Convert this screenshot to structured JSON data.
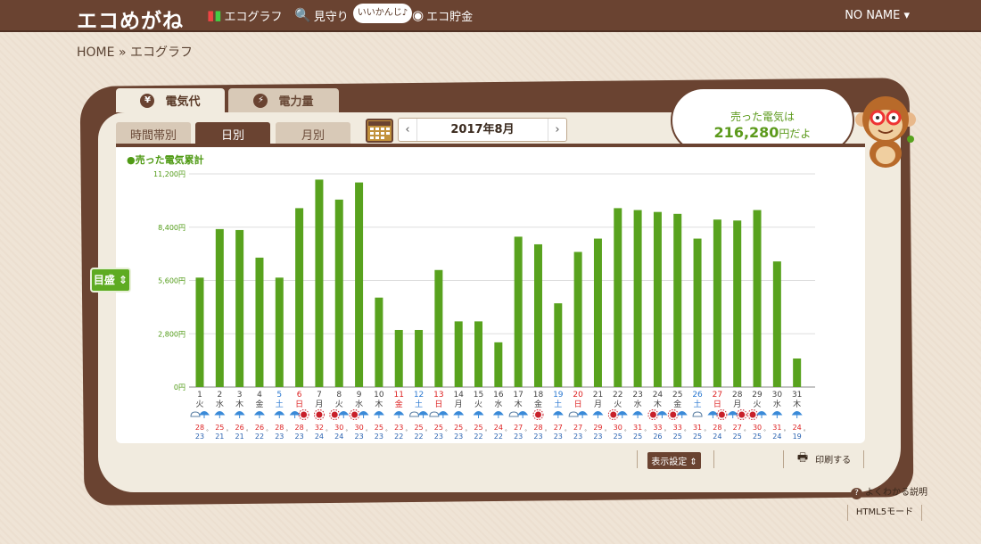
{
  "header": {
    "logo": "エコめがね",
    "nav": [
      {
        "label": "エコグラフ",
        "icon": "chart-icon"
      },
      {
        "label": "見守り",
        "icon": "magnifier-icon"
      },
      {
        "label": "エコ貯金",
        "icon": "coin-icon"
      }
    ],
    "bubble": "いいかんじ♪",
    "user": "NO NAME ▾"
  },
  "breadcrumb": {
    "home": "HOME",
    "sep": "»",
    "current": "エコグラフ"
  },
  "tabs": {
    "primary": [
      {
        "label": "電気代",
        "icon": "¥"
      },
      {
        "label": "電力量",
        "icon": "⚡"
      }
    ],
    "period": [
      "時間帯別",
      "日別",
      "月別"
    ],
    "active_period": "日別"
  },
  "date_nav": {
    "prev": "‹",
    "label": "2017年8月",
    "next": "›"
  },
  "speech": {
    "line1": "売った電気は",
    "amount": "216,280",
    "unit": "円だよ"
  },
  "goal_button": "目盛 ⇕",
  "footer": {
    "display_settings": "表示設定 ⇕",
    "print": "印刷する",
    "help": "よくわかる説明",
    "html5": "HTML5モード"
  },
  "chart_data": {
    "type": "bar",
    "title": "●売った電気累計",
    "ylim": [
      0,
      11200
    ],
    "yticks": [
      "0円",
      "2,800円",
      "5,600円",
      "8,400円",
      "11,200円"
    ],
    "ytick_values": [
      0,
      2800,
      5600,
      8400,
      11200
    ],
    "color": "#58a21e",
    "categories": [
      "1",
      "2",
      "3",
      "4",
      "5",
      "6",
      "7",
      "8",
      "9",
      "10",
      "11",
      "12",
      "13",
      "14",
      "15",
      "16",
      "17",
      "18",
      "19",
      "20",
      "21",
      "22",
      "23",
      "24",
      "25",
      "26",
      "27",
      "28",
      "29",
      "30",
      "31"
    ],
    "weekdays": [
      "火",
      "水",
      "木",
      "金",
      "土",
      "日",
      "月",
      "火",
      "水",
      "木",
      "金",
      "土",
      "日",
      "月",
      "火",
      "水",
      "木",
      "金",
      "土",
      "日",
      "月",
      "火",
      "水",
      "木",
      "金",
      "土",
      "日",
      "月",
      "火",
      "水",
      "木"
    ],
    "day_colors": [
      "n",
      "n",
      "n",
      "n",
      "sat",
      "sun",
      "n",
      "n",
      "n",
      "n",
      "sun",
      "sat",
      "sun",
      "n",
      "n",
      "n",
      "n",
      "n",
      "sat",
      "sun",
      "n",
      "n",
      "n",
      "n",
      "n",
      "sat",
      "sun",
      "n",
      "n",
      "n",
      "n"
    ],
    "values": [
      5750,
      8300,
      8250,
      6800,
      5750,
      9400,
      10900,
      9850,
      10750,
      4700,
      3000,
      3000,
      6150,
      3450,
      3450,
      2350,
      7900,
      7500,
      4400,
      7100,
      7800,
      9400,
      9300,
      9200,
      9100,
      7800,
      8800,
      8750,
      9300,
      6600,
      1500
    ],
    "weather": [
      "cloud-umbrella",
      "umbrella",
      "umbrella",
      "umbrella",
      "umbrella",
      "umbrella-sun",
      "sun",
      "sun-umbrella",
      "sun-umbrella",
      "umbrella",
      "umbrella",
      "cloud-umbrella",
      "cloud-umbrella",
      "umbrella",
      "umbrella",
      "umbrella",
      "cloud-umbrella",
      "sun",
      "umbrella",
      "cloud-umbrella",
      "umbrella",
      "sun-umbrella",
      "umbrella",
      "sun-umbrella",
      "sun-umbrella",
      "cloud",
      "umbrella-sun",
      "umbrella-sun",
      "sun-umbrella",
      "umbrella",
      "umbrella"
    ],
    "temp_high": [
      "28",
      "25",
      "26",
      "26",
      "28",
      "28",
      "32",
      "30",
      "30",
      "25",
      "23",
      "25",
      "25",
      "25",
      "25",
      "24",
      "27",
      "28",
      "27",
      "27",
      "29",
      "30",
      "31",
      "33",
      "33",
      "31",
      "28",
      "27",
      "30",
      "31",
      "24"
    ],
    "temp_low": [
      "23",
      "21",
      "21",
      "22",
      "23",
      "23",
      "24",
      "24",
      "23",
      "23",
      "22",
      "22",
      "23",
      "23",
      "22",
      "22",
      "23",
      "23",
      "23",
      "23",
      "23",
      "25",
      "25",
      "26",
      "25",
      "25",
      "24",
      "25",
      "25",
      "24",
      "19"
    ],
    "temp_unit": "°"
  }
}
